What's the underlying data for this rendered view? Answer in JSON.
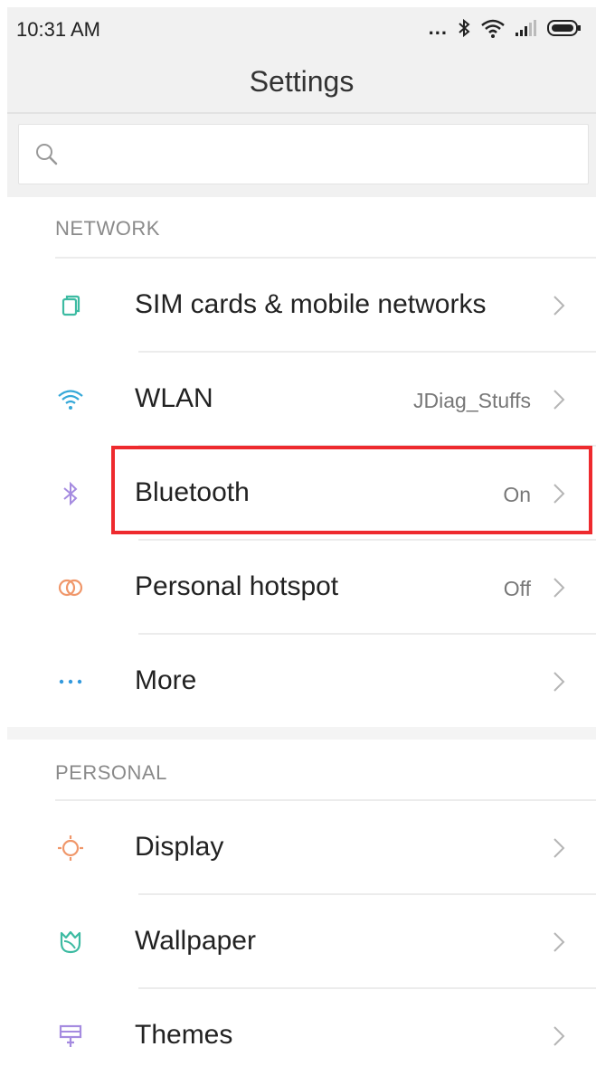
{
  "status_bar": {
    "time": "10:31 AM",
    "signal_dots": "..."
  },
  "header": {
    "title": "Settings"
  },
  "search": {
    "value": "",
    "placeholder": ""
  },
  "colors": {
    "sim": "#3dbba2",
    "wlan": "#35a8d8",
    "bluetooth": "#a58be0",
    "hotspot": "#f0976a",
    "more": "#3399dd",
    "display": "#f0976a",
    "wallpaper": "#3dbba2",
    "themes": "#a58be0",
    "highlight": "#ee2a2e"
  },
  "sections": [
    {
      "header": "NETWORK",
      "items": [
        {
          "label": "SIM cards & mobile networks",
          "value": "",
          "icon": "sim-card-icon"
        },
        {
          "label": "WLAN",
          "value": "JDiag_Stuffs",
          "icon": "wifi-icon"
        },
        {
          "label": "Bluetooth",
          "value": "On",
          "icon": "bluetooth-icon"
        },
        {
          "label": "Personal hotspot",
          "value": "Off",
          "icon": "hotspot-icon"
        },
        {
          "label": "More",
          "value": "",
          "icon": "more-dots-icon"
        }
      ]
    },
    {
      "header": "PERSONAL",
      "items": [
        {
          "label": "Display",
          "value": "",
          "icon": "sun-icon"
        },
        {
          "label": "Wallpaper",
          "value": "",
          "icon": "tulip-icon"
        },
        {
          "label": "Themes",
          "value": "",
          "icon": "brush-icon"
        }
      ]
    }
  ]
}
